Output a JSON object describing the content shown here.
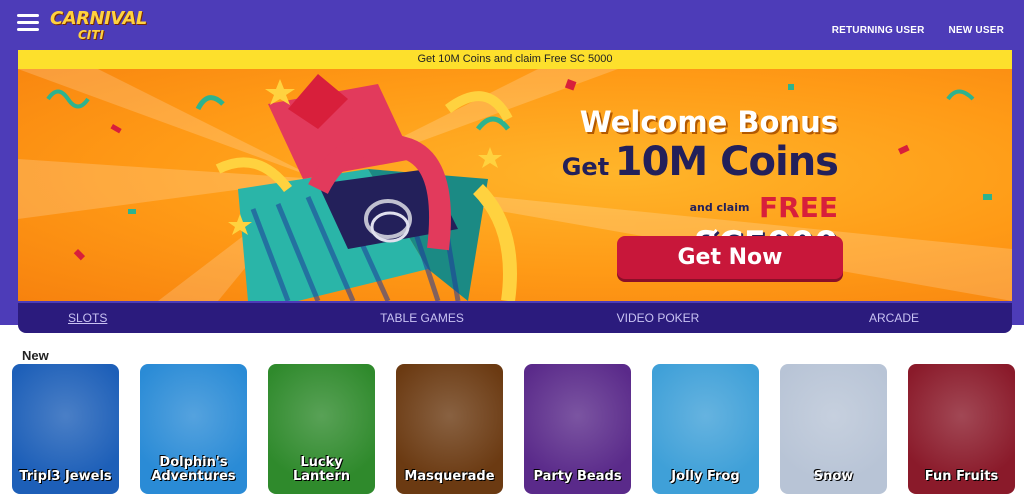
{
  "header": {
    "logo_line1": "CARNIVAL",
    "logo_line2": "CITI",
    "returning_user": "RETURNING USER",
    "new_user": "NEW USER"
  },
  "promo_strip": "Get 10M Coins and claim Free SC 5000",
  "banner": {
    "title": "Welcome Bonus",
    "get": "Get",
    "coins": "10M Coins",
    "and_claim": "and claim",
    "free": "FREE",
    "sc": "S̸C5000",
    "cta": "Get Now"
  },
  "tabs": [
    "SLOTS",
    "TABLE GAMES",
    "VIDEO POKER",
    "ARCADE"
  ],
  "section_title": "New",
  "games": [
    {
      "name": "Tripl3 Jewels",
      "bg": "#1d5fb8"
    },
    {
      "name": "Dolphin's Adventures",
      "bg": "#2a8bd6"
    },
    {
      "name": "Lucky Lantern",
      "bg": "#2f8a2c"
    },
    {
      "name": "Masquerade",
      "bg": "#6b3a12"
    },
    {
      "name": "Party Beads",
      "bg": "#5a2a8a"
    },
    {
      "name": "Jolly Frog",
      "bg": "#3fa0d8"
    },
    {
      "name": "Snow",
      "bg": "#b8c4d6"
    },
    {
      "name": "Fun Fruits",
      "bg": "#8a1a2a"
    }
  ],
  "colors": {
    "header_bg": "#4d3cb8",
    "strip": "#fde02c",
    "cta": "#c8173a",
    "tabs_bg": "#2b1b7d"
  }
}
